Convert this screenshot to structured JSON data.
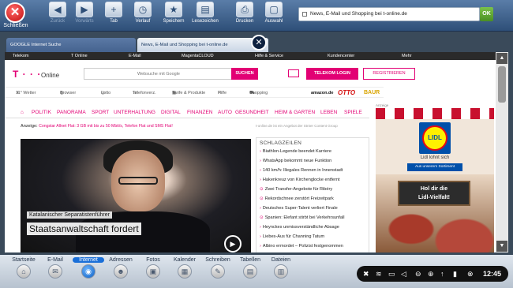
{
  "toolbar": {
    "close_label": "Schließen",
    "buttons": [
      {
        "label": "Zurück",
        "icon": "back-icon"
      },
      {
        "label": "Vorwärts",
        "icon": "forward-icon"
      },
      {
        "label": "Tab",
        "icon": "new-tab-icon"
      },
      {
        "label": "Verlauf",
        "icon": "history-icon"
      },
      {
        "label": "Speichern",
        "icon": "bookmark-icon"
      },
      {
        "label": "Lesezeichen",
        "icon": "bookmarks-icon"
      },
      {
        "label": "Drucken",
        "icon": "print-icon"
      },
      {
        "label": "Auswahl",
        "icon": "selection-icon"
      }
    ],
    "url": "News, E-Mail und Shopping bei t-online.de",
    "ok_label": "OK"
  },
  "tabs": [
    {
      "title": "GOOGLE Internet Suche"
    },
    {
      "title": "News, E-Mail und Shopping bei t-online.de"
    }
  ],
  "site": {
    "topnav": [
      "Telekom",
      "T Online",
      "E-Mail",
      "MagentaCLOUD",
      "Hilfe & Service",
      "Kundencenter",
      "Mehr"
    ],
    "logo": "T · · ·",
    "logo_suffix": "Online",
    "search_placeholder": "Websuche mit Google",
    "search_button": "SUCHEN",
    "login_button": "TELEKOM LOGIN",
    "register_button": "REGISTRIEREN",
    "shortcuts": [
      "11° Wetter",
      "Browser",
      "Lotto",
      "Telefonverz.",
      "Tarife & Produkte",
      "Hilfe",
      "Shopping"
    ],
    "brands": [
      "amazon.de",
      "OTTO",
      "BAUR"
    ],
    "categories": [
      "POLITIK",
      "PANORAMA",
      "SPORT",
      "UNTERHALTUNG",
      "DIGITAL",
      "FINANZEN",
      "AUTO",
      "GESUNDHEIT",
      "HEIM & GARTEN",
      "LEBEN",
      "SPIELE"
    ],
    "promo_prefix": "Anzeige:",
    "promo_text": "Congstar Allnet Flat: 3 GB mit bis zu 50 Mbit/s, Telefon Flat und SMS Flat!",
    "promo_right": "t-online.de ist ein Angebot der Ströer Content Group",
    "hero_kicker": "Katalanischer Separatistenführer",
    "hero_title": "Staatsanwaltschaft fordert",
    "headlines_title": "SCHLAGZEILEN",
    "headlines": [
      "Biathlon-Legende beendet Karriere",
      "WhatsApp bekommt neue Funktion",
      "140 km/h: Illegales Rennen in Innenstadt",
      "Hakenkreuz von Kirchenglocke entfernt",
      "Zwei Transfer-Angebote für Ribéry",
      "Rekordschnee zerstört Freizeitpark",
      "Deutsches Super-Talent verliert Finale",
      "Spanien: Elefant stirbt bei Verkehrsunfall",
      "Heynckes unmissverständliche Absage",
      "Liebes-Aus für Channing Tatum",
      "Albino ermordet – Polizist festgenommen"
    ],
    "ad_label": "Anzeige",
    "ad_logo": "LIDL",
    "ad_slogan": "Lidl lohnt sich",
    "ad_sub": "Aus unserem Sortiment",
    "ad_board_line1": "Hol dir die",
    "ad_board_line2": "Lidl-Vielfalt!"
  },
  "dock": {
    "items": [
      {
        "label": "Startseite",
        "icon": "home-icon"
      },
      {
        "label": "E-Mail",
        "icon": "mail-icon"
      },
      {
        "label": "Internet",
        "icon": "globe-icon"
      },
      {
        "label": "Adressen",
        "icon": "contacts-icon"
      },
      {
        "label": "Fotos",
        "icon": "photos-icon"
      },
      {
        "label": "Kalender",
        "icon": "calendar-icon"
      },
      {
        "label": "Schreiben",
        "icon": "write-icon"
      },
      {
        "label": "Tabellen",
        "icon": "spreadsheet-icon"
      },
      {
        "label": "Dateien",
        "icon": "files-icon"
      }
    ],
    "active": "Internet"
  },
  "tray": {
    "time": "12:45"
  },
  "colors": {
    "brand": "#e20074",
    "toolbar": "#2e4f78",
    "dock_active": "#1a6fd8"
  }
}
